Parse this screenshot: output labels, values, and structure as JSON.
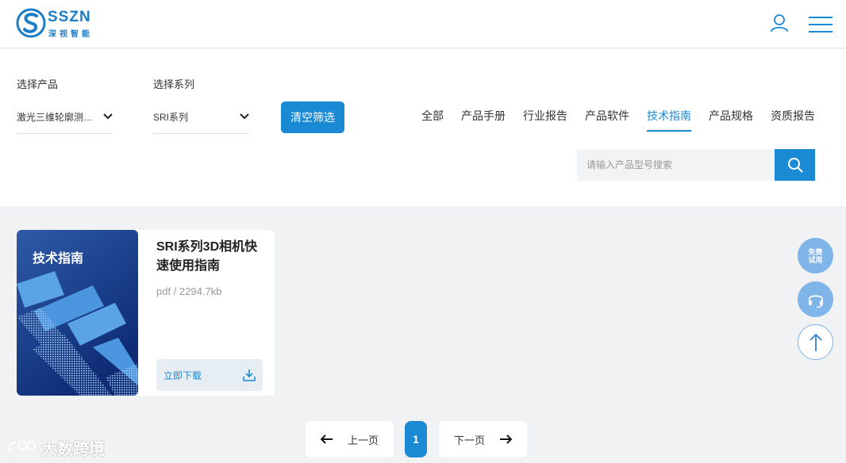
{
  "brand": {
    "name": "SSZN",
    "subtitle": "深视智能",
    "accent": "#1a8ad4"
  },
  "header": {
    "user_icon": "user-icon",
    "menu_icon": "hamburger-menu-icon"
  },
  "filters": {
    "product_label": "选择产品",
    "product_value": "激光三维轮廓测…",
    "series_label": "选择系列",
    "series_value": "SRI系列",
    "clear_label": "清空筛选"
  },
  "tabs": [
    {
      "label": "全部",
      "active": false
    },
    {
      "label": "产品手册",
      "active": false
    },
    {
      "label": "行业报告",
      "active": false
    },
    {
      "label": "产品软件",
      "active": false
    },
    {
      "label": "技术指南",
      "active": true
    },
    {
      "label": "产品规格",
      "active": false
    },
    {
      "label": "资质报告",
      "active": false
    }
  ],
  "search": {
    "placeholder": "请输入产品型号搜索",
    "value": ""
  },
  "documents": [
    {
      "cover_title": "技术指南",
      "title": "SRI系列3D相机快速使用指南",
      "meta": "pdf / 2294.7kb",
      "download_label": "立即下载"
    }
  ],
  "side_float": {
    "trial_label": "免费试用"
  },
  "pagination": {
    "prev_label": "上一页",
    "next_label": "下一页",
    "current_page": "1"
  },
  "watermark": {
    "text": "大数跨境"
  }
}
